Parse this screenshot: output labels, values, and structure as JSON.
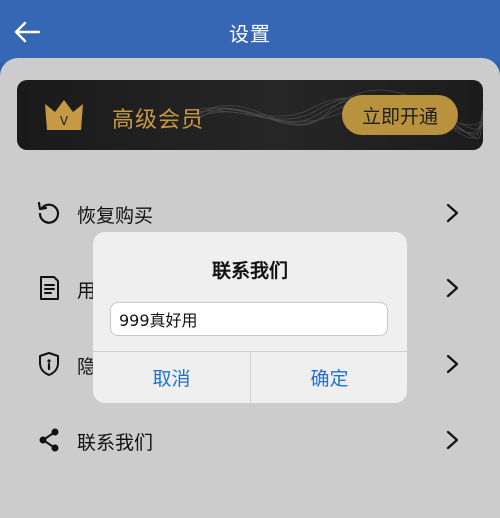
{
  "header": {
    "title": "设置",
    "back_icon": "arrow-left-icon"
  },
  "vip": {
    "title": "高级会员",
    "crown_letter": "V",
    "button_label": "立即开通",
    "accent_color": "#c69a45"
  },
  "menu": [
    {
      "label": "恢复购买",
      "icon": "restore-icon"
    },
    {
      "label": "用",
      "icon": "document-icon"
    },
    {
      "label": "隐",
      "icon": "shield-icon"
    },
    {
      "label": "联系我们",
      "icon": "share-icon"
    }
  ],
  "dialog": {
    "title": "联系我们",
    "input_value": "999真好用",
    "cancel_label": "取消",
    "confirm_label": "确定",
    "button_color": "#1e72d6"
  }
}
